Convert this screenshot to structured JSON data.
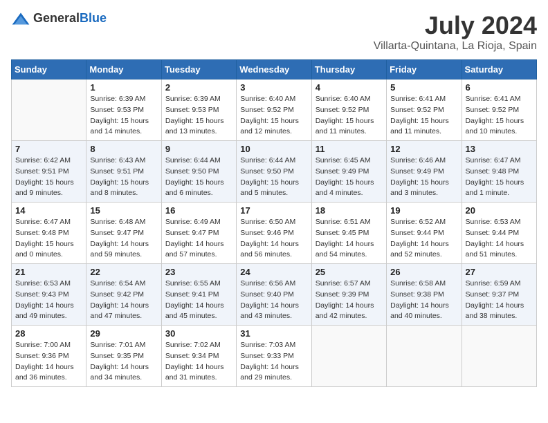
{
  "logo": {
    "text_general": "General",
    "text_blue": "Blue"
  },
  "title": "July 2024",
  "location": "Villarta-Quintana, La Rioja, Spain",
  "weekdays": [
    "Sunday",
    "Monday",
    "Tuesday",
    "Wednesday",
    "Thursday",
    "Friday",
    "Saturday"
  ],
  "weeks": [
    [
      {
        "day": "",
        "empty": true
      },
      {
        "day": "1",
        "sunrise": "6:39 AM",
        "sunset": "9:53 PM",
        "daylight": "15 hours and 14 minutes."
      },
      {
        "day": "2",
        "sunrise": "6:39 AM",
        "sunset": "9:53 PM",
        "daylight": "15 hours and 13 minutes."
      },
      {
        "day": "3",
        "sunrise": "6:40 AM",
        "sunset": "9:52 PM",
        "daylight": "15 hours and 12 minutes."
      },
      {
        "day": "4",
        "sunrise": "6:40 AM",
        "sunset": "9:52 PM",
        "daylight": "15 hours and 11 minutes."
      },
      {
        "day": "5",
        "sunrise": "6:41 AM",
        "sunset": "9:52 PM",
        "daylight": "15 hours and 11 minutes."
      },
      {
        "day": "6",
        "sunrise": "6:41 AM",
        "sunset": "9:52 PM",
        "daylight": "15 hours and 10 minutes."
      }
    ],
    [
      {
        "day": "7",
        "sunrise": "6:42 AM",
        "sunset": "9:51 PM",
        "daylight": "15 hours and 9 minutes."
      },
      {
        "day": "8",
        "sunrise": "6:43 AM",
        "sunset": "9:51 PM",
        "daylight": "15 hours and 8 minutes."
      },
      {
        "day": "9",
        "sunrise": "6:44 AM",
        "sunset": "9:50 PM",
        "daylight": "15 hours and 6 minutes."
      },
      {
        "day": "10",
        "sunrise": "6:44 AM",
        "sunset": "9:50 PM",
        "daylight": "15 hours and 5 minutes."
      },
      {
        "day": "11",
        "sunrise": "6:45 AM",
        "sunset": "9:49 PM",
        "daylight": "15 hours and 4 minutes."
      },
      {
        "day": "12",
        "sunrise": "6:46 AM",
        "sunset": "9:49 PM",
        "daylight": "15 hours and 3 minutes."
      },
      {
        "day": "13",
        "sunrise": "6:47 AM",
        "sunset": "9:48 PM",
        "daylight": "15 hours and 1 minute."
      }
    ],
    [
      {
        "day": "14",
        "sunrise": "6:47 AM",
        "sunset": "9:48 PM",
        "daylight": "15 hours and 0 minutes."
      },
      {
        "day": "15",
        "sunrise": "6:48 AM",
        "sunset": "9:47 PM",
        "daylight": "14 hours and 59 minutes."
      },
      {
        "day": "16",
        "sunrise": "6:49 AM",
        "sunset": "9:47 PM",
        "daylight": "14 hours and 57 minutes."
      },
      {
        "day": "17",
        "sunrise": "6:50 AM",
        "sunset": "9:46 PM",
        "daylight": "14 hours and 56 minutes."
      },
      {
        "day": "18",
        "sunrise": "6:51 AM",
        "sunset": "9:45 PM",
        "daylight": "14 hours and 54 minutes."
      },
      {
        "day": "19",
        "sunrise": "6:52 AM",
        "sunset": "9:44 PM",
        "daylight": "14 hours and 52 minutes."
      },
      {
        "day": "20",
        "sunrise": "6:53 AM",
        "sunset": "9:44 PM",
        "daylight": "14 hours and 51 minutes."
      }
    ],
    [
      {
        "day": "21",
        "sunrise": "6:53 AM",
        "sunset": "9:43 PM",
        "daylight": "14 hours and 49 minutes."
      },
      {
        "day": "22",
        "sunrise": "6:54 AM",
        "sunset": "9:42 PM",
        "daylight": "14 hours and 47 minutes."
      },
      {
        "day": "23",
        "sunrise": "6:55 AM",
        "sunset": "9:41 PM",
        "daylight": "14 hours and 45 minutes."
      },
      {
        "day": "24",
        "sunrise": "6:56 AM",
        "sunset": "9:40 PM",
        "daylight": "14 hours and 43 minutes."
      },
      {
        "day": "25",
        "sunrise": "6:57 AM",
        "sunset": "9:39 PM",
        "daylight": "14 hours and 42 minutes."
      },
      {
        "day": "26",
        "sunrise": "6:58 AM",
        "sunset": "9:38 PM",
        "daylight": "14 hours and 40 minutes."
      },
      {
        "day": "27",
        "sunrise": "6:59 AM",
        "sunset": "9:37 PM",
        "daylight": "14 hours and 38 minutes."
      }
    ],
    [
      {
        "day": "28",
        "sunrise": "7:00 AM",
        "sunset": "9:36 PM",
        "daylight": "14 hours and 36 minutes."
      },
      {
        "day": "29",
        "sunrise": "7:01 AM",
        "sunset": "9:35 PM",
        "daylight": "14 hours and 34 minutes."
      },
      {
        "day": "30",
        "sunrise": "7:02 AM",
        "sunset": "9:34 PM",
        "daylight": "14 hours and 31 minutes."
      },
      {
        "day": "31",
        "sunrise": "7:03 AM",
        "sunset": "9:33 PM",
        "daylight": "14 hours and 29 minutes."
      },
      {
        "day": "",
        "empty": true
      },
      {
        "day": "",
        "empty": true
      },
      {
        "day": "",
        "empty": true
      }
    ]
  ],
  "labels": {
    "sunrise": "Sunrise:",
    "sunset": "Sunset:",
    "daylight": "Daylight:"
  }
}
